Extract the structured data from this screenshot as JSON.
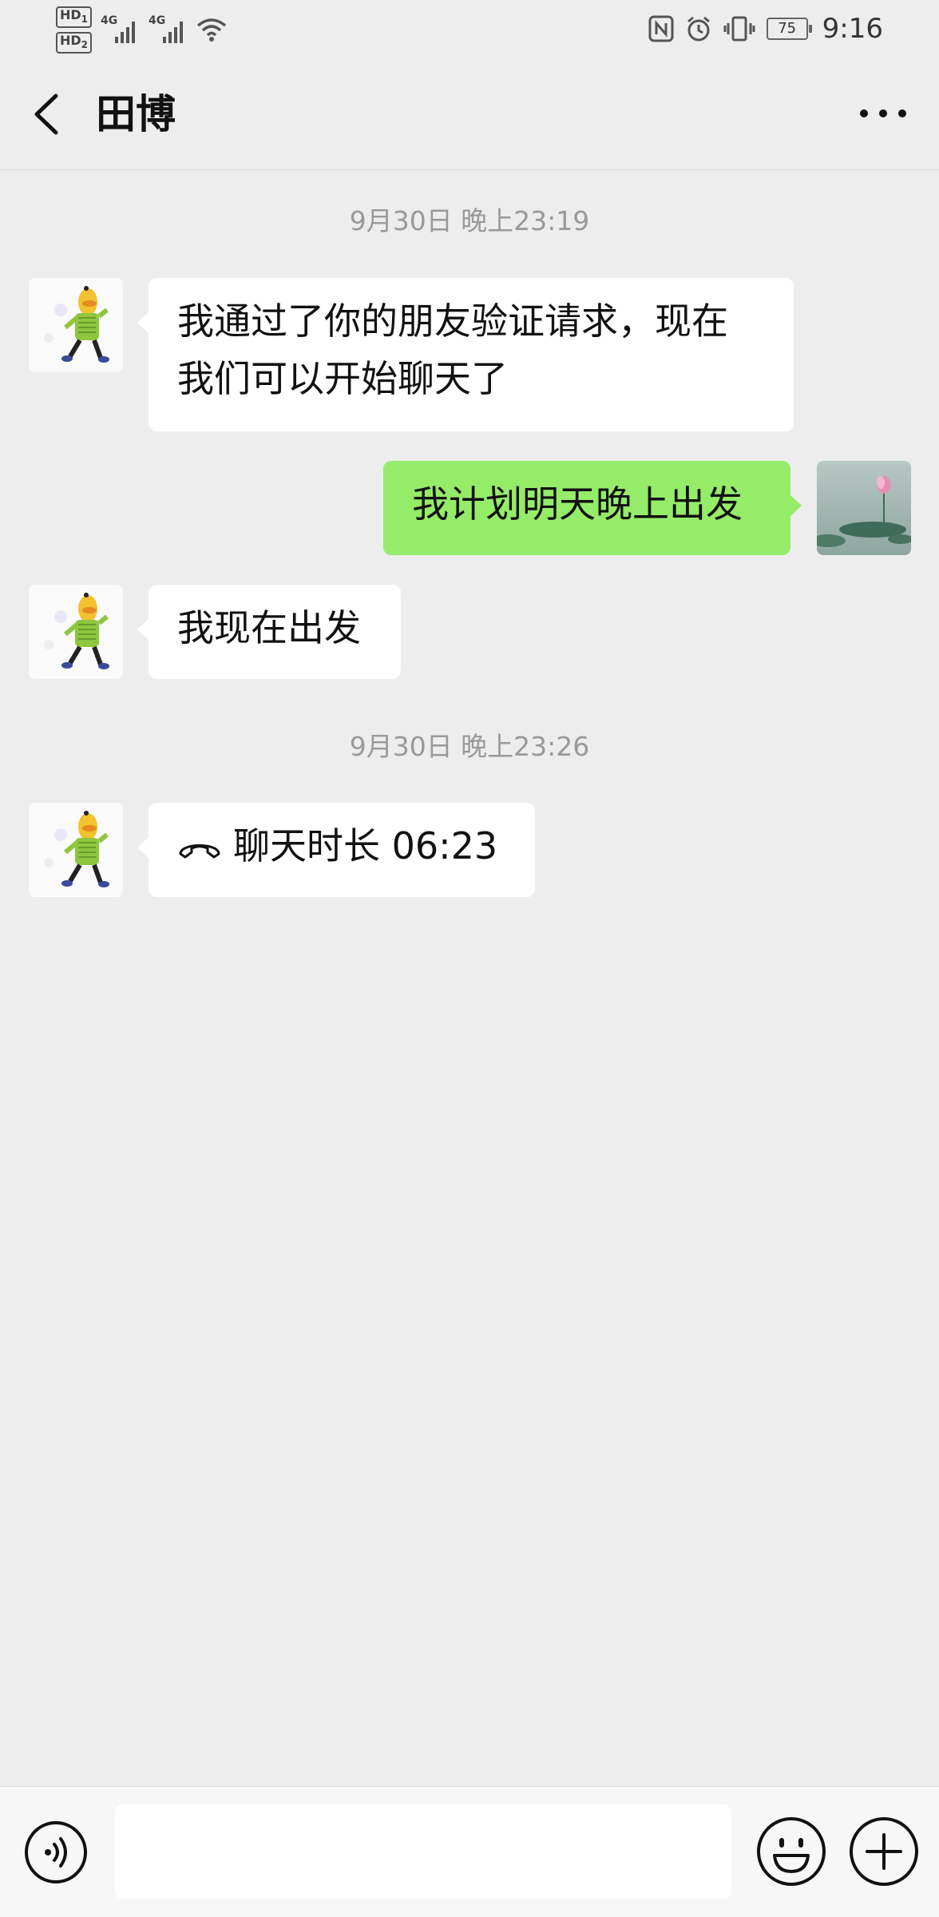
{
  "status_bar": {
    "hd1": "HD",
    "hd1_sub": "1",
    "hd2": "HD",
    "hd2_sub": "2",
    "signal1_label": "4G",
    "signal2_label": "4G",
    "battery_level": "75",
    "time": "9:16",
    "icons": [
      "nfc-icon",
      "alarm-icon",
      "vibrate-icon",
      "wifi-icon"
    ]
  },
  "header": {
    "title": "田博"
  },
  "messages": [
    {
      "type": "timestamp",
      "text": "9月30日 晚上23:19"
    },
    {
      "type": "text",
      "side": "left",
      "text_line1": "我通过了你的朋友验证请求，现在",
      "text_line2": "我们可以开始聊天了"
    },
    {
      "type": "text",
      "side": "right",
      "text": "我计划明天晚上出发"
    },
    {
      "type": "text",
      "side": "left",
      "text": "我现在出发"
    },
    {
      "type": "timestamp",
      "text": "9月30日 晚上23:26"
    },
    {
      "type": "call",
      "side": "left",
      "text": "聊天时长 06:23"
    }
  ],
  "input_bar": {
    "placeholder": "",
    "value": ""
  },
  "colors": {
    "background": "#ededed",
    "bubble_self": "#95ec69",
    "bubble_other": "#ffffff"
  }
}
